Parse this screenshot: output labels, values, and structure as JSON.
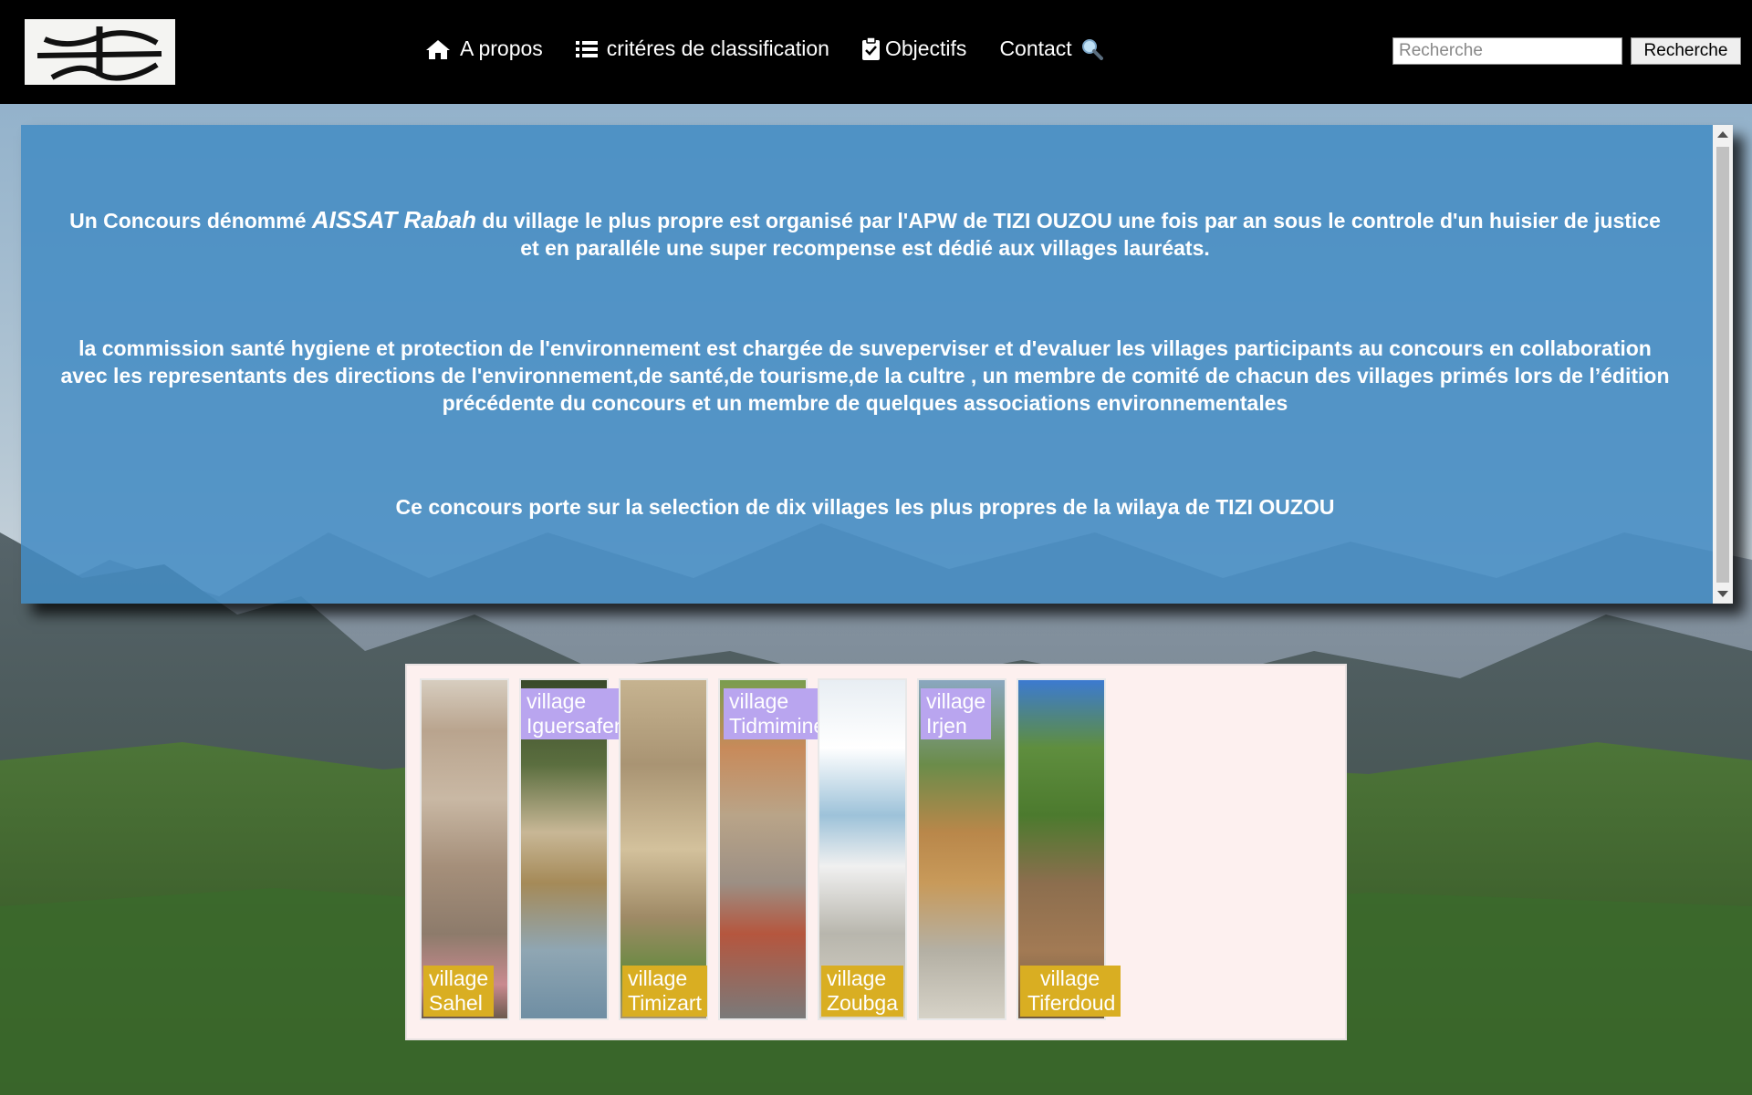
{
  "nav": {
    "items": [
      {
        "label": "A propos",
        "icon": "home-icon"
      },
      {
        "label": "critéres de classification",
        "icon": "list-icon"
      },
      {
        "label": "Objectifs",
        "icon": "clipboard-check-icon"
      },
      {
        "label": "Contact",
        "icon": "magnifier-icon"
      }
    ],
    "search_placeholder": "Recherche",
    "search_button": "Recherche"
  },
  "info": {
    "p1_before": "Un Concours dénommé ",
    "p1_name": "AISSAT Rabah",
    "p1_after": " du village le plus propre est organisé par l'APW de TIZI OUZOU une fois par an sous le controle d'un huisier de justice et en paralléle une super recompense est dédié aux villages lauréats.",
    "p2": "la commission santé hygiene et protection de l'environnement est chargée de suveperviser et d'evaluer les villages participants au concours en collaboration avec les representants des directions de l'environnement,de santé,de tourisme,de la cultre , un membre de comité de chacun des villages primés lors de l’édition précédente du concours et un membre de quelques associations environnementales",
    "p3": "Ce concours porte sur la selection de dix villages les plus propres de la wilaya de TIZI OUZOU"
  },
  "villages": [
    {
      "line1": "village",
      "line2": "Sahel",
      "position": "bottom",
      "tag_color": "#d9ae22"
    },
    {
      "line1": "village",
      "line2": "Iguersafene",
      "position": "top",
      "tag_color": "#b9a5ef"
    },
    {
      "line1": "village",
      "line2": "Timizart",
      "position": "bottom",
      "tag_color": "#d9ae22"
    },
    {
      "line1": "village",
      "line2": "Tidmimine",
      "position": "top",
      "tag_color": "#b9a5ef"
    },
    {
      "line1": "village",
      "line2": "Zoubga",
      "position": "bottom",
      "tag_color": "#d9ae22"
    },
    {
      "line1": "village",
      "line2": "Irjen",
      "position": "top",
      "tag_color": "#b9a5ef"
    },
    {
      "line1": "village",
      "line2": "Tiferdoud",
      "position": "bottom",
      "tag_color": "#d9ae22"
    }
  ]
}
